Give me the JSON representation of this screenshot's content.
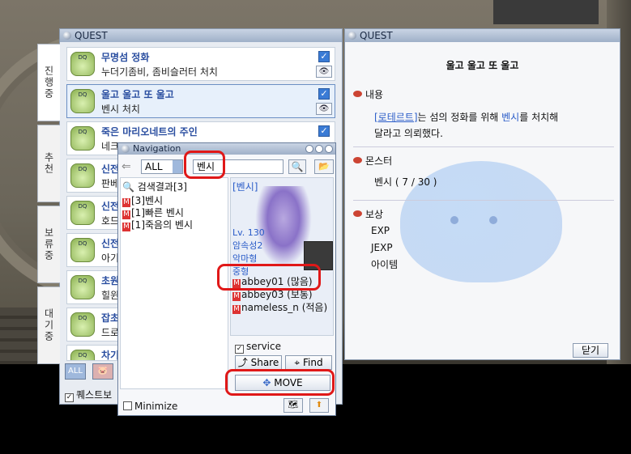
{
  "quest_list": {
    "title": "QUEST",
    "tabs": [
      "진행중",
      "추천",
      "보류중",
      "대기중"
    ],
    "items": [
      {
        "title": "무명섬 정화",
        "sub": "누더기좀비, 좀비슬러터 처치",
        "checked": true
      },
      {
        "title": "울고 울고 또 울고",
        "sub": "벤시 처치",
        "checked": true,
        "selected": true
      },
      {
        "title": "죽은 마리오네트의 주인",
        "sub": "네크",
        "checked": true
      },
      {
        "title": "신전",
        "sub": "판베"
      },
      {
        "title": "신전",
        "sub": "호드"
      },
      {
        "title": "신전",
        "sub": "아기"
      },
      {
        "title": "초원",
        "sub": "힐윈"
      },
      {
        "title": "잡초",
        "sub": "드로"
      },
      {
        "title": "차기",
        "sub": ""
      }
    ],
    "bottom_btn": "ALL",
    "footer_label": "퀘스트보"
  },
  "quest_detail": {
    "title": "QUEST",
    "quest_name": "울고 울고 또 울고",
    "content_header": "내용",
    "content_link": "[로테르트]",
    "content_mid": "는 섬의 정화를 위해 ",
    "content_target": "벤시",
    "content_end": "를 처치해",
    "content_line2": "달라고 의뢰했다.",
    "monster_header": "몬스터",
    "monster_text": "벤시 ( 7 / 30 )",
    "reward_header": "보상",
    "rewards": [
      "EXP",
      "JEXP",
      "아이템"
    ],
    "close_label": "닫기"
  },
  "navigation": {
    "title": "Navigation",
    "filter": "ALL",
    "search_value": "벤시",
    "results_header": "검색결과[3]",
    "results": [
      "[3]벤시",
      "[1]빠른 벤시",
      "[1]죽음의 벤시"
    ],
    "mob_name": "[벤시]",
    "mob_info": [
      "Lv. 130",
      "암속성2",
      "악마형",
      "중형"
    ],
    "channels": [
      {
        "name": "abbey01",
        "status": "(많음)"
      },
      {
        "name": "abbey03",
        "status": "(보통)"
      },
      {
        "name": "nameless_n",
        "status": "(적음)"
      }
    ],
    "service_label": "service",
    "share_label": "Share",
    "find_label": "Find",
    "move_label": "MOVE",
    "minimize_label": "Minimize"
  }
}
